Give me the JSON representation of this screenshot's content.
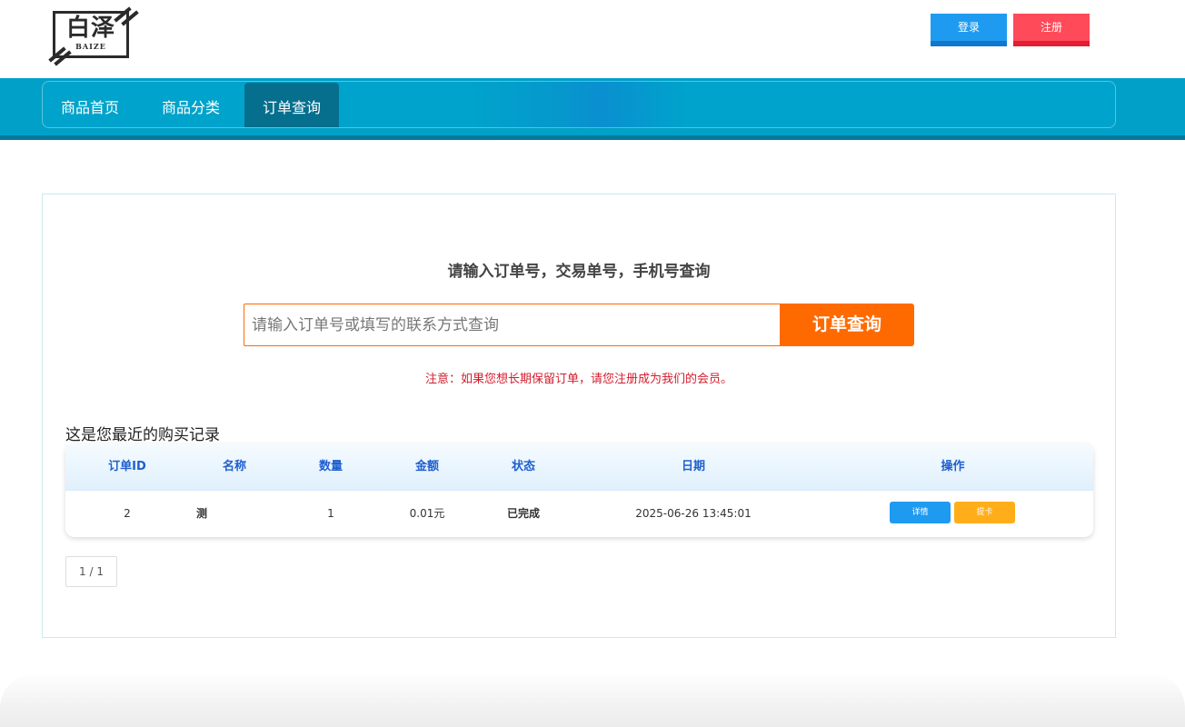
{
  "header": {
    "logo_text": "白泽",
    "logo_subtext": "BAIZE",
    "login_label": "登录",
    "register_label": "注册"
  },
  "nav": {
    "items": [
      {
        "label": "商品首页",
        "active": false
      },
      {
        "label": "商品分类",
        "active": false
      },
      {
        "label": "订单查询",
        "active": true
      }
    ]
  },
  "query": {
    "title": "请输入订单号，交易单号，手机号查询",
    "placeholder": "请输入订单号或填写的联系方式查询",
    "value": "",
    "button_label": "订单查询",
    "notice": "注意：如果您想长期保留订单，请您注册成为我们的会员。"
  },
  "records": {
    "title": "这是您最近的购买记录",
    "columns": [
      "订单ID",
      "名称",
      "数量",
      "金额",
      "状态",
      "日期",
      "操作"
    ],
    "rows": [
      {
        "id": "2",
        "name": "测",
        "qty": "1",
        "amount": "0.01元",
        "status": "已完成",
        "date": "2025-06-26 13:45:01",
        "detail_label": "详情",
        "card_label": "提卡"
      }
    ]
  },
  "pagination": {
    "text": "1 / 1"
  },
  "colors": {
    "nav_bg": "#00a0c8",
    "accent_orange": "#ff6a00",
    "login_blue": "#1e9bf0",
    "register_red": "#ff4a5a",
    "status_green": "#1a9a2a",
    "notice_red": "#d21d2d"
  }
}
